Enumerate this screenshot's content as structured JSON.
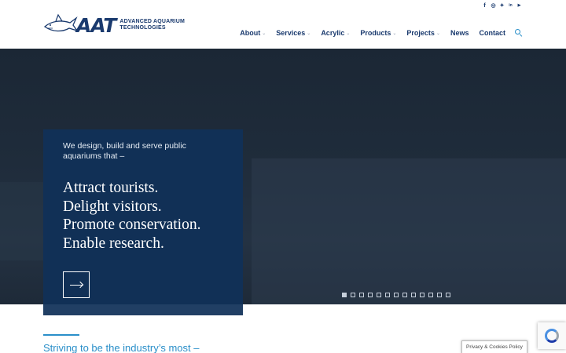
{
  "header": {
    "logo": {
      "wordmark": "AAT",
      "subtitle_line1": "ADVANCED AQUARIUM",
      "subtitle_line2": "TECHNOLOGIES"
    },
    "social": [
      {
        "icon": "facebook-icon",
        "glyph": "f"
      },
      {
        "icon": "instagram-icon",
        "glyph": "◎"
      },
      {
        "icon": "twitter-icon",
        "glyph": "✦"
      },
      {
        "icon": "linkedin-icon",
        "glyph": "in"
      },
      {
        "icon": "youtube-icon",
        "glyph": "▶"
      }
    ],
    "nav": {
      "about": "About",
      "services": "Services",
      "acrylic": "Acrylic",
      "products": "Products",
      "projects": "Projects",
      "news": "News",
      "contact": "Contact"
    }
  },
  "hero": {
    "intro": "We design, build and serve public aquariums that –",
    "lines": [
      "Attract tourists.",
      "Delight visitors.",
      "Promote conservation.",
      "Enable research."
    ],
    "slides_total": 13,
    "active_slide": 1
  },
  "below": {
    "tagline": "Striving to be the industry’s most –"
  },
  "footer_widgets": {
    "privacy_label": "Privacy & Cookies Policy"
  },
  "colors": {
    "brand_navy": "#1a3a6e",
    "accent_blue": "#2a8fc9",
    "panel": "#103058"
  }
}
